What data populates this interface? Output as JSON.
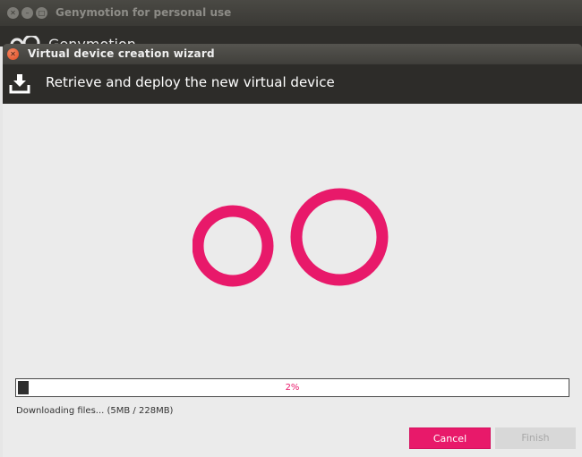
{
  "parent_window": {
    "title": "Genymotion for personal use",
    "brand": "Genymotion"
  },
  "wizard": {
    "title": "Virtual device creation wizard",
    "heading": "Retrieve and deploy the new virtual device",
    "progress": {
      "value": 0.02,
      "label": "2%"
    },
    "status_text": "Downloading files... (5MB / 228MB)",
    "buttons": {
      "cancel": "Cancel",
      "finish": "Finish"
    }
  },
  "colors": {
    "accent": "#e8196a",
    "header_bg": "#2d2c29",
    "body_bg": "#ebebeb"
  },
  "icons": {
    "close": "close-icon",
    "download": "download-icon",
    "logo": "genymotion-logo"
  }
}
